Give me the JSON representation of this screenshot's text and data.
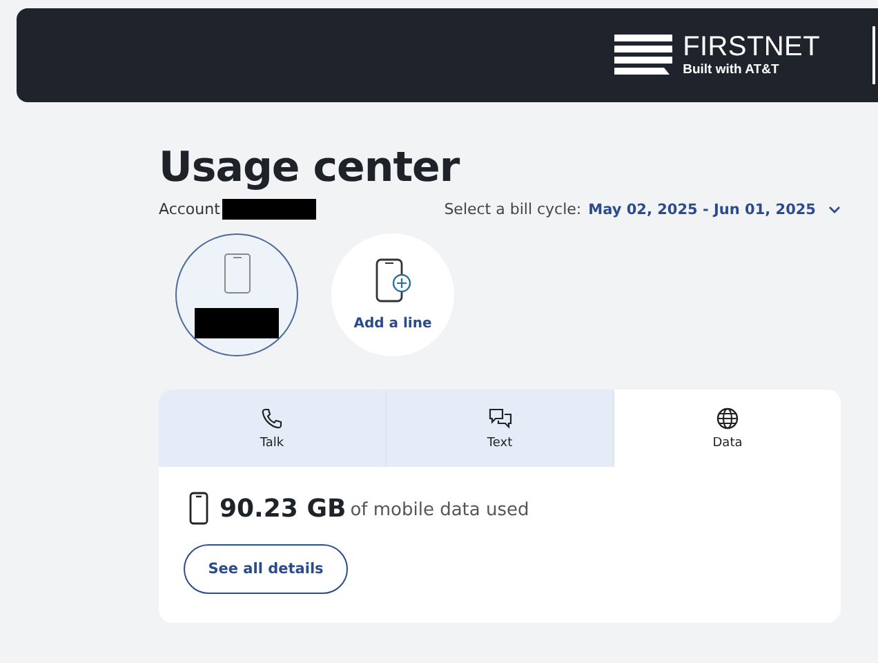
{
  "header": {
    "logo_title": "**FIRST**NET",
    "logo_subtitle": "Built with AT&T"
  },
  "title": "Usage center",
  "account": {
    "label": "Account",
    "redacted": true
  },
  "bill_cycle": {
    "label": "Select a bill cycle:",
    "value": "May 02, 2025 - Jun 01, 2025"
  },
  "lines": [
    {
      "kind": "line",
      "redacted": true,
      "selected": true
    },
    {
      "kind": "add",
      "label": "Add a line",
      "selected": false
    }
  ],
  "tabs": [
    {
      "kind": "talk",
      "label": "Talk",
      "selected": false
    },
    {
      "kind": "text",
      "label": "Text",
      "selected": false
    },
    {
      "kind": "data",
      "label": "Data",
      "selected": true
    }
  ],
  "usage": {
    "amount": "90.23 GB",
    "description": "of mobile data used"
  },
  "details_button": "See all details"
}
